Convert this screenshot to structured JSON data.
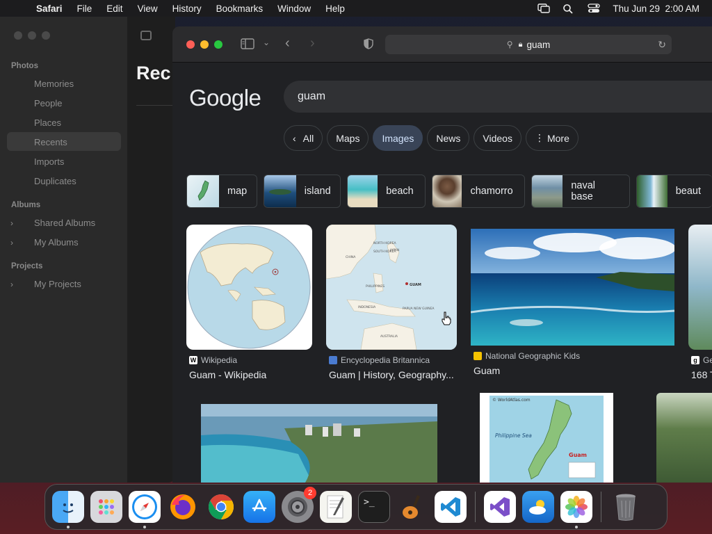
{
  "menubar": {
    "app": "Safari",
    "items": [
      "File",
      "Edit",
      "View",
      "History",
      "Bookmarks",
      "Window",
      "Help"
    ],
    "datetime": "Thu Jun 29  2:00 AM",
    "status_icons": [
      "screen-mirroring-icon",
      "spotlight-search-icon",
      "control-center-icon"
    ]
  },
  "photos": {
    "title": "Rec",
    "sections": {
      "photos": "Photos",
      "albums": "Albums",
      "projects": "Projects"
    },
    "photos_items": [
      "Memories",
      "People",
      "Places",
      "Recents",
      "Imports",
      "Duplicates"
    ],
    "album_items": [
      "Shared Albums",
      "My Albums"
    ],
    "project_items": [
      "My Projects"
    ],
    "selected": "Recents"
  },
  "safari": {
    "url": "guam"
  },
  "google": {
    "logo": "Google",
    "query": "guam",
    "tabs": [
      "All",
      "Maps",
      "Images",
      "News",
      "Videos",
      "More"
    ],
    "active_tab": "Images",
    "chips": [
      {
        "label": "map",
        "color": "#7fb3c9"
      },
      {
        "label": "island",
        "color": "#3a6fa0"
      },
      {
        "label": "beach",
        "color": "#5fc6c8"
      },
      {
        "label": "chamorro",
        "color": "#8a6a50"
      },
      {
        "label": "naval base",
        "color": "#5e7f96"
      },
      {
        "label": "beaut",
        "color": "#4a7a3a"
      }
    ],
    "results": [
      {
        "source": "Wikipedia",
        "title": "Guam - Wikipedia",
        "fav_color": "#ffffff"
      },
      {
        "source": "Encyclopedia Britannica",
        "title": "Guam | History, Geography...",
        "fav_color": "#4a7bd0"
      },
      {
        "source": "National Geographic Kids",
        "title": "Guam",
        "fav_color": "#f5c200"
      },
      {
        "source": "Ge",
        "title": "168 T",
        "fav_color": "#ffffff"
      }
    ],
    "britannica_map_labels": [
      "NORTH KOREA",
      "SOUTH KOREA",
      "JAPAN",
      "CHINA",
      "PHILIPPINES",
      "GUAM",
      "INDONESIA",
      "PAPUA NEW GUINEA",
      "AUSTRALIA"
    ],
    "worldatlas": {
      "watermark": "© WorldAtlas.com",
      "sea": "Philippine Sea",
      "label": "Guam"
    }
  },
  "dock": {
    "apps": [
      "Finder",
      "Launchpad",
      "Safari",
      "Firefox",
      "Chrome",
      "App Store",
      "System Settings",
      "TextEdit",
      "Terminal",
      "GarageBand",
      "VS Code",
      "Visual Studio",
      "Weather",
      "Photos",
      "Trash"
    ],
    "badge": "2"
  }
}
